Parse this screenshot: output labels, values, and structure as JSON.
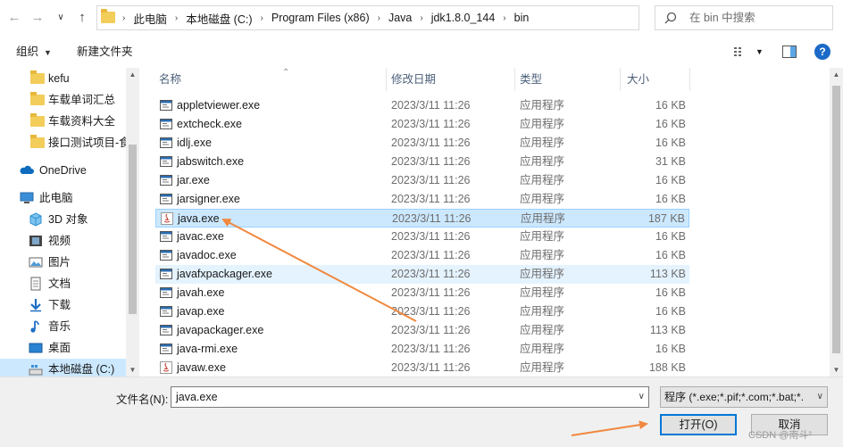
{
  "colors": {
    "accent": "#0078d7",
    "selection": "#cce8ff",
    "hover": "#e5f3ff",
    "annotation_arrow": "#f0883e"
  },
  "address": {
    "crumbs": [
      "此电脑",
      "本地磁盘 (C:)",
      "Program Files (x86)",
      "Java",
      "jdk1.8.0_144",
      "bin"
    ]
  },
  "search": {
    "placeholder": "在 bin 中搜索"
  },
  "toolbar": {
    "organize_label": "组织",
    "new_folder_label": "新建文件夹"
  },
  "nav": {
    "items": [
      {
        "label": "kefu",
        "icon": "folder-icon"
      },
      {
        "label": "车载单词汇总",
        "icon": "folder-icon"
      },
      {
        "label": "车载资料大全",
        "icon": "folder-icon"
      },
      {
        "label": "接口测试项目-食",
        "icon": "folder-icon"
      },
      {
        "label": "OneDrive",
        "icon": "onedrive-cloud-icon"
      },
      {
        "label": "此电脑",
        "icon": "this-pc-icon"
      },
      {
        "label": "3D 对象",
        "icon": "3d-objects-icon"
      },
      {
        "label": "视频",
        "icon": "videos-icon"
      },
      {
        "label": "图片",
        "icon": "pictures-icon"
      },
      {
        "label": "文档",
        "icon": "documents-icon"
      },
      {
        "label": "下载",
        "icon": "downloads-icon"
      },
      {
        "label": "音乐",
        "icon": "music-icon"
      },
      {
        "label": "桌面",
        "icon": "desktop-icon"
      },
      {
        "label": "本地磁盘 (C:)",
        "icon": "local-disk-icon"
      }
    ]
  },
  "columns": {
    "name": "名称",
    "date": "修改日期",
    "type": "类型",
    "size": "大小"
  },
  "files": [
    {
      "name": "appletviewer.exe",
      "date": "2023/3/11 11:26",
      "type": "应用程序",
      "size": "16 KB",
      "icon": "exe-icon"
    },
    {
      "name": "extcheck.exe",
      "date": "2023/3/11 11:26",
      "type": "应用程序",
      "size": "16 KB",
      "icon": "exe-icon"
    },
    {
      "name": "idlj.exe",
      "date": "2023/3/11 11:26",
      "type": "应用程序",
      "size": "16 KB",
      "icon": "exe-icon"
    },
    {
      "name": "jabswitch.exe",
      "date": "2023/3/11 11:26",
      "type": "应用程序",
      "size": "31 KB",
      "icon": "exe-icon"
    },
    {
      "name": "jar.exe",
      "date": "2023/3/11 11:26",
      "type": "应用程序",
      "size": "16 KB",
      "icon": "exe-icon"
    },
    {
      "name": "jarsigner.exe",
      "date": "2023/3/11 11:26",
      "type": "应用程序",
      "size": "16 KB",
      "icon": "exe-icon"
    },
    {
      "name": "java.exe",
      "date": "2023/3/11 11:26",
      "type": "应用程序",
      "size": "187 KB",
      "icon": "java-icon"
    },
    {
      "name": "javac.exe",
      "date": "2023/3/11 11:26",
      "type": "应用程序",
      "size": "16 KB",
      "icon": "exe-icon"
    },
    {
      "name": "javadoc.exe",
      "date": "2023/3/11 11:26",
      "type": "应用程序",
      "size": "16 KB",
      "icon": "exe-icon"
    },
    {
      "name": "javafxpackager.exe",
      "date": "2023/3/11 11:26",
      "type": "应用程序",
      "size": "113 KB",
      "icon": "exe-icon"
    },
    {
      "name": "javah.exe",
      "date": "2023/3/11 11:26",
      "type": "应用程序",
      "size": "16 KB",
      "icon": "exe-icon"
    },
    {
      "name": "javap.exe",
      "date": "2023/3/11 11:26",
      "type": "应用程序",
      "size": "16 KB",
      "icon": "exe-icon"
    },
    {
      "name": "javapackager.exe",
      "date": "2023/3/11 11:26",
      "type": "应用程序",
      "size": "113 KB",
      "icon": "exe-icon"
    },
    {
      "name": "java-rmi.exe",
      "date": "2023/3/11 11:26",
      "type": "应用程序",
      "size": "16 KB",
      "icon": "exe-icon"
    },
    {
      "name": "javaw.exe",
      "date": "2023/3/11 11:26",
      "type": "应用程序",
      "size": "188 KB",
      "icon": "java-icon"
    }
  ],
  "bottom": {
    "filename_label": "文件名(N):",
    "filename_value": "java.exe",
    "filter_value": "程序 (*.exe;*.pif;*.com;*.bat;*.",
    "open_label": "打开(O)",
    "cancel_label": "取消"
  },
  "watermark": "CSDN @南斗²"
}
